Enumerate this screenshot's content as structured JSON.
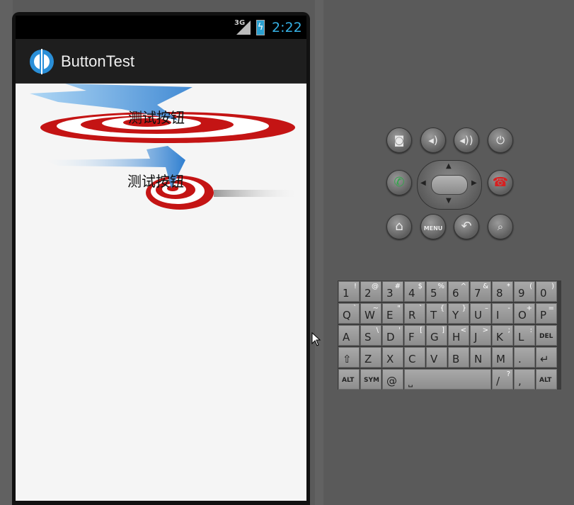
{
  "status_bar": {
    "network": "3G",
    "time": "2:22"
  },
  "app": {
    "title": "ButtonTest"
  },
  "buttons": [
    {
      "label": "测试按钮"
    },
    {
      "label": "测试按钮"
    }
  ],
  "emulator": {
    "hardware_buttons": [
      {
        "name": "camera-button",
        "icon": "camera-icon",
        "glyph": "📷"
      },
      {
        "name": "volume-down-button",
        "icon": "volume-down-icon",
        "glyph": "🔉"
      },
      {
        "name": "volume-up-button",
        "icon": "volume-up-icon",
        "glyph": "🔊"
      },
      {
        "name": "power-button",
        "icon": "power-icon",
        "glyph": "⏻"
      },
      {
        "name": "call-button",
        "icon": "phone-icon",
        "glyph": "✆"
      },
      {
        "name": "end-call-button",
        "icon": "hangup-icon",
        "glyph": "☎"
      },
      {
        "name": "home-button",
        "icon": "home-icon",
        "glyph": "⌂"
      },
      {
        "name": "menu-button",
        "icon": "menu-icon",
        "glyph": "MENU"
      },
      {
        "name": "back-button",
        "icon": "back-icon",
        "glyph": "↶"
      },
      {
        "name": "search-button",
        "icon": "search-icon",
        "glyph": "🔍"
      }
    ],
    "keyboard_rows": [
      [
        [
          "1",
          "!"
        ],
        [
          "2",
          "@"
        ],
        [
          "3",
          "#"
        ],
        [
          "4",
          "$"
        ],
        [
          "5",
          "%"
        ],
        [
          "6",
          "^"
        ],
        [
          "7",
          "&"
        ],
        [
          "8",
          "*"
        ],
        [
          "9",
          "("
        ],
        [
          "0",
          ")"
        ]
      ],
      [
        [
          "Q",
          "`"
        ],
        [
          "W",
          "~"
        ],
        [
          "E",
          "\""
        ],
        [
          "R",
          "`"
        ],
        [
          "T",
          "{"
        ],
        [
          "Y",
          "}"
        ],
        [
          "U",
          "–"
        ],
        [
          "I",
          "-"
        ],
        [
          "O",
          "+"
        ],
        [
          "P",
          "="
        ]
      ],
      [
        [
          "A",
          ""
        ],
        [
          "S",
          "\\"
        ],
        [
          "D",
          "'"
        ],
        [
          "F",
          "["
        ],
        [
          "G",
          "]"
        ],
        [
          "H",
          "<"
        ],
        [
          "J",
          ">"
        ],
        [
          "K",
          ";"
        ],
        [
          "L",
          ":"
        ],
        [
          "DEL",
          ""
        ]
      ],
      [
        [
          "⇧",
          ""
        ],
        [
          "Z",
          ""
        ],
        [
          "X",
          ""
        ],
        [
          "C",
          ""
        ],
        [
          "V",
          ""
        ],
        [
          "B",
          ""
        ],
        [
          "N",
          ""
        ],
        [
          "M",
          ""
        ],
        [
          ".",
          ""
        ],
        [
          "↵",
          ""
        ]
      ],
      [
        [
          "ALT",
          ""
        ],
        [
          "SYM",
          ""
        ],
        [
          "@",
          ""
        ],
        [
          "space",
          ""
        ],
        [
          "/",
          "?"
        ],
        [
          ",",
          ""
        ],
        [
          "ALT",
          ""
        ]
      ]
    ]
  }
}
